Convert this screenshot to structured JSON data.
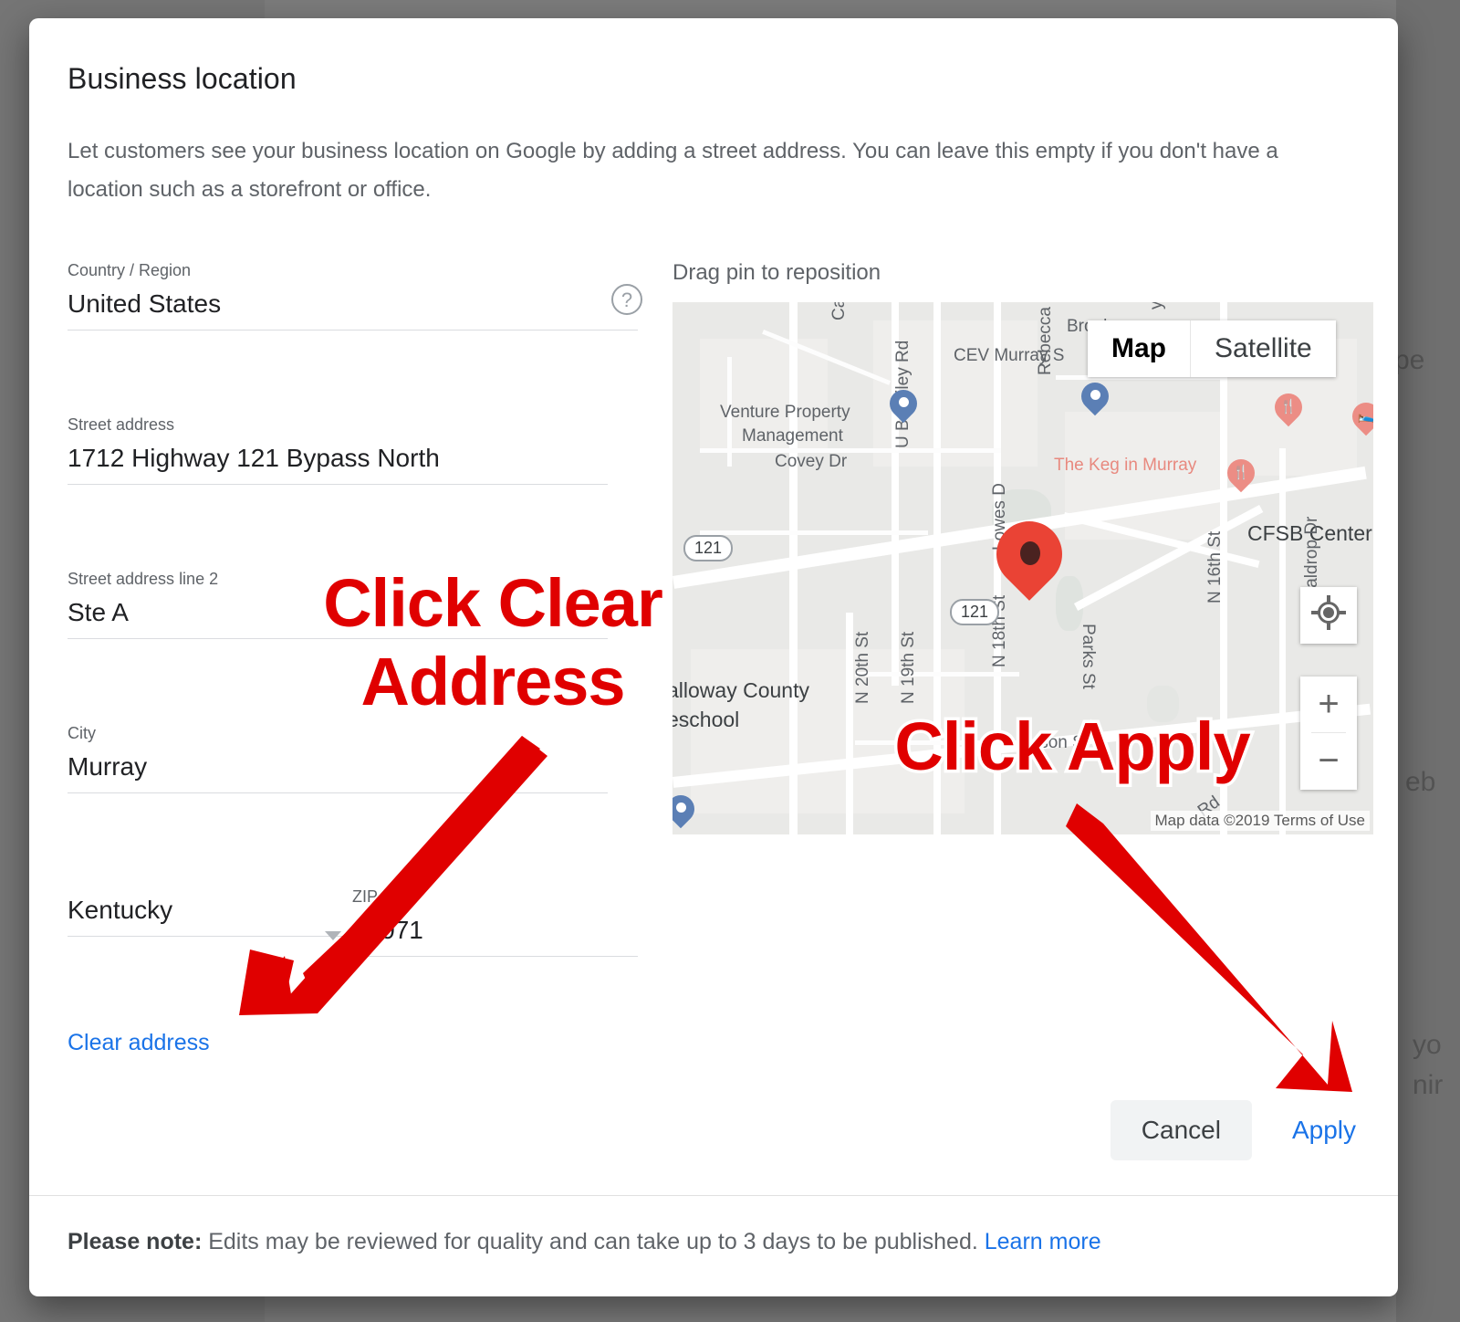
{
  "dialog": {
    "title": "Business location",
    "description": "Let customers see your business location on Google by adding a street address. You can leave this empty if you don't have a location such as a storefront or office."
  },
  "form": {
    "country": {
      "label": "Country / Region",
      "value": "United States",
      "help_icon": "help-circle-icon"
    },
    "street1": {
      "label": "Street address",
      "value": "1712 Highway 121 Bypass North"
    },
    "street2": {
      "label": "Street address line 2",
      "value": "Ste A"
    },
    "city": {
      "label": "City",
      "value": "Murray"
    },
    "state": {
      "label": "",
      "value": "Kentucky"
    },
    "zip": {
      "label": "ZIP code",
      "value": "42071"
    },
    "clear_address": "Clear address"
  },
  "map": {
    "caption": "Drag pin to reposition",
    "types": {
      "map": "Map",
      "satellite": "Satellite",
      "selected": "Map"
    },
    "attribution": "Map data ©2019   Terms of Use",
    "controls": {
      "locate": "my-location-icon",
      "zoom_in": "+",
      "zoom_out": "−"
    },
    "labels": [
      "Cambridg",
      "CEV Murray S",
      "Venture Property",
      "Management",
      "Rebecca Run",
      "Covey Dr",
      "The Keg in Murray",
      "U B Bailey Rd",
      "Lowes D",
      "CFSB Center",
      "N 16th St",
      "Waldrop Dr",
      "N 18th St",
      "Parks St",
      "alloway County",
      "eschool",
      "N 20th St",
      "N 19th St",
      "lson St",
      "Brook",
      "y L",
      "Rd",
      "St",
      "121"
    ]
  },
  "actions": {
    "cancel": "Cancel",
    "apply": "Apply"
  },
  "footer": {
    "bold": "Please note:",
    "text": " Edits may be reviewed for quality and can take up to 3 days to be published. ",
    "link": "Learn more"
  },
  "annotations": {
    "clear": "Click Clear\nAddress",
    "apply": "Click Apply",
    "color": "#e00000"
  },
  "background": {
    "fragments": [
      "pe",
      "eb",
      "yo",
      "nir"
    ]
  }
}
